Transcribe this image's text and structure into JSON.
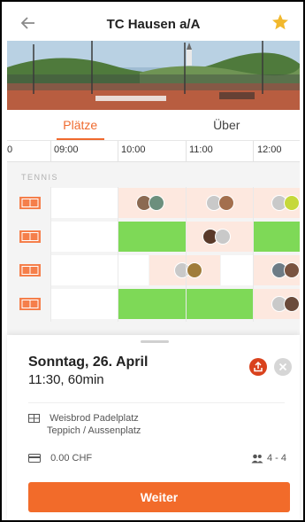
{
  "header": {
    "back_icon": "arrow-left-icon",
    "title": "TC Hausen a/A",
    "favorite_icon": "star-icon",
    "favorite_color": "#f1b82d"
  },
  "tabs": [
    {
      "label": "Plätze",
      "active": true
    },
    {
      "label": "Über",
      "active": false
    }
  ],
  "timeline": {
    "ticks": [
      "0",
      "09:00",
      "10:00",
      "11:00",
      "12:00"
    ]
  },
  "grid": {
    "section_label": "TENNIS",
    "courts": [
      {
        "icon": "tennis-court-icon"
      },
      {
        "icon": "tennis-court-icon"
      },
      {
        "icon": "tennis-court-icon"
      },
      {
        "icon": "tennis-court-icon"
      }
    ],
    "status_colors": {
      "booked": "#fde8df",
      "free": "#7ed957",
      "open": "#ffffff"
    }
  },
  "sheet": {
    "date": "Sonntag, 26. April",
    "time": "11:30, 60min",
    "share_icon": "share-icon",
    "close_icon": "close-icon",
    "court_name": "Weisbrod Padelplatz",
    "court_surface": "Teppich / Aussenplatz",
    "price": "0.00 CHF",
    "players": "4 - 4",
    "cta_label": "Weiter"
  },
  "accent": "#f26b2a"
}
